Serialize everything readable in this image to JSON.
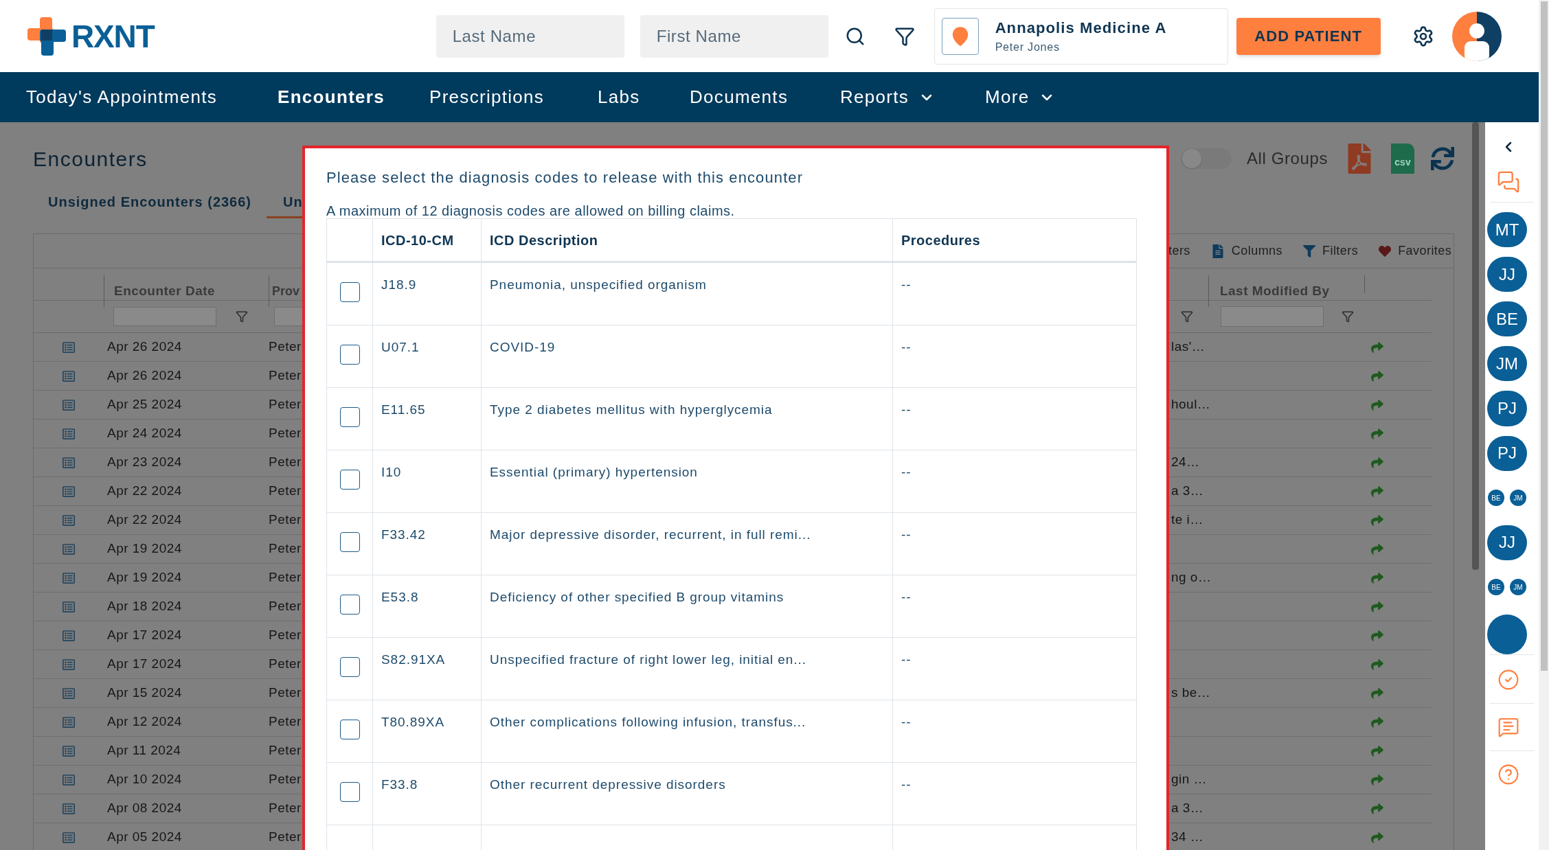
{
  "header": {
    "logo": "RXNT",
    "last_name": {
      "placeholder": "Last Name"
    },
    "first_name": {
      "placeholder": "First Name"
    },
    "location": {
      "name": "Annapolis Medicine A",
      "user": "Peter Jones"
    },
    "add_button": "ADD PATIENT"
  },
  "nav": [
    {
      "label": "Today's Appointments",
      "selected": false,
      "has_menu": false
    },
    {
      "label": "Encounters",
      "selected": true,
      "has_menu": false
    },
    {
      "label": "Prescriptions",
      "selected": false,
      "has_menu": false
    },
    {
      "label": "Labs",
      "selected": false,
      "has_menu": false
    },
    {
      "label": "Documents",
      "selected": false,
      "has_menu": false
    },
    {
      "label": "Reports",
      "selected": false,
      "has_menu": true
    },
    {
      "label": "More",
      "selected": false,
      "has_menu": true
    }
  ],
  "page": {
    "title": "Encounters",
    "tabs": [
      {
        "label": "Unsigned Encounters (2366)",
        "selected": false
      },
      {
        "label": "Un",
        "selected": true
      }
    ],
    "all_groups": {
      "label": "All Groups",
      "on": false
    },
    "exports": [
      {
        "kind": "pdf"
      },
      {
        "kind": "csv",
        "label": "csv"
      },
      {
        "kind": "refresh"
      }
    ],
    "toolbar": [
      {
        "kind": "text",
        "label": "ters"
      },
      {
        "kind": "columns",
        "label": "Columns"
      },
      {
        "kind": "filters",
        "label": "Filters"
      },
      {
        "kind": "favorites",
        "label": "Favorites"
      }
    ],
    "grid": {
      "columns": [
        "Encounter Date",
        "Prov",
        "Last Modified By"
      ],
      "rows": [
        {
          "date": "Apr 26 2024",
          "provider": "Peter",
          "note": "las'…"
        },
        {
          "date": "Apr 26 2024",
          "provider": "Peter"
        },
        {
          "date": "Apr 25 2024",
          "provider": "Peter",
          "note": "houl…"
        },
        {
          "date": "Apr 24 2024",
          "provider": "Peter"
        },
        {
          "date": "Apr 23 2024",
          "provider": "Peter",
          "note": "24…"
        },
        {
          "date": "Apr 22 2024",
          "provider": "Peter",
          "note": "a 3…"
        },
        {
          "date": "Apr 22 2024",
          "provider": "Peter",
          "note": "te i…"
        },
        {
          "date": "Apr 19 2024",
          "provider": "Peter"
        },
        {
          "date": "Apr 19 2024",
          "provider": "Peter",
          "note": "ng o…"
        },
        {
          "date": "Apr 18 2024",
          "provider": "Peter"
        },
        {
          "date": "Apr 17 2024",
          "provider": "Peter"
        },
        {
          "date": "Apr 17 2024",
          "provider": "Peter"
        },
        {
          "date": "Apr 15 2024",
          "provider": "Peter",
          "note": "s be…"
        },
        {
          "date": "Apr 12 2024",
          "provider": "Peter"
        },
        {
          "date": "Apr 11 2024",
          "provider": "Peter"
        },
        {
          "date": "Apr 10 2024",
          "provider": "Peter",
          "note": "gin …"
        },
        {
          "date": "Apr 08 2024",
          "provider": "Peter",
          "note": "a 3…"
        },
        {
          "date": "Apr 05 2024",
          "provider": "Peter",
          "note": "34 …"
        }
      ]
    }
  },
  "modal": {
    "prompt": "Please select the diagnosis codes to release with this encounter",
    "note": "A maximum of 12 diagnosis codes are allowed on billing claims.",
    "columns": [
      "ICD-10-CM",
      "ICD Description",
      "Procedures"
    ],
    "rows": [
      {
        "code": "J18.9",
        "description": "Pneumonia, unspecified organism",
        "procedures": "--",
        "checked": false
      },
      {
        "code": "U07.1",
        "description": "COVID-19",
        "procedures": "--",
        "checked": false
      },
      {
        "code": "E11.65",
        "description": "Type 2 diabetes mellitus with hyperglycemia",
        "procedures": "--",
        "checked": false
      },
      {
        "code": "I10",
        "description": "Essential (primary) hypertension",
        "procedures": "--",
        "checked": false
      },
      {
        "code": "F33.42",
        "description": "Major depressive disorder, recurrent, in full remi...",
        "procedures": "--",
        "checked": false
      },
      {
        "code": "E53.8",
        "description": "Deficiency of other specified B group vitamins",
        "procedures": "--",
        "checked": false
      },
      {
        "code": "S82.91XA",
        "description": "Unspecified fracture of right lower leg, initial en...",
        "procedures": "--",
        "checked": false
      },
      {
        "code": "T80.89XA",
        "description": "Other complications following infusion, transfus...",
        "procedures": "--",
        "checked": false
      },
      {
        "code": "F33.8",
        "description": "Other recurrent depressive disorders",
        "procedures": "--",
        "checked": false
      }
    ]
  },
  "sidebar": {
    "avatars": [
      {
        "kind": "single",
        "initials": [
          "MT"
        ]
      },
      {
        "kind": "single",
        "initials": [
          "JJ"
        ]
      },
      {
        "kind": "single",
        "initials": [
          "BE"
        ]
      },
      {
        "kind": "single",
        "initials": [
          "JM"
        ]
      },
      {
        "kind": "single",
        "initials": [
          "PJ"
        ]
      },
      {
        "kind": "single",
        "initials": [
          "PJ"
        ]
      },
      {
        "kind": "pair",
        "initials": [
          "BE",
          "JM"
        ]
      },
      {
        "kind": "single",
        "initials": [
          "JJ"
        ]
      },
      {
        "kind": "pair",
        "initials": [
          "BE",
          "JM"
        ]
      },
      {
        "kind": "partial"
      }
    ]
  }
}
